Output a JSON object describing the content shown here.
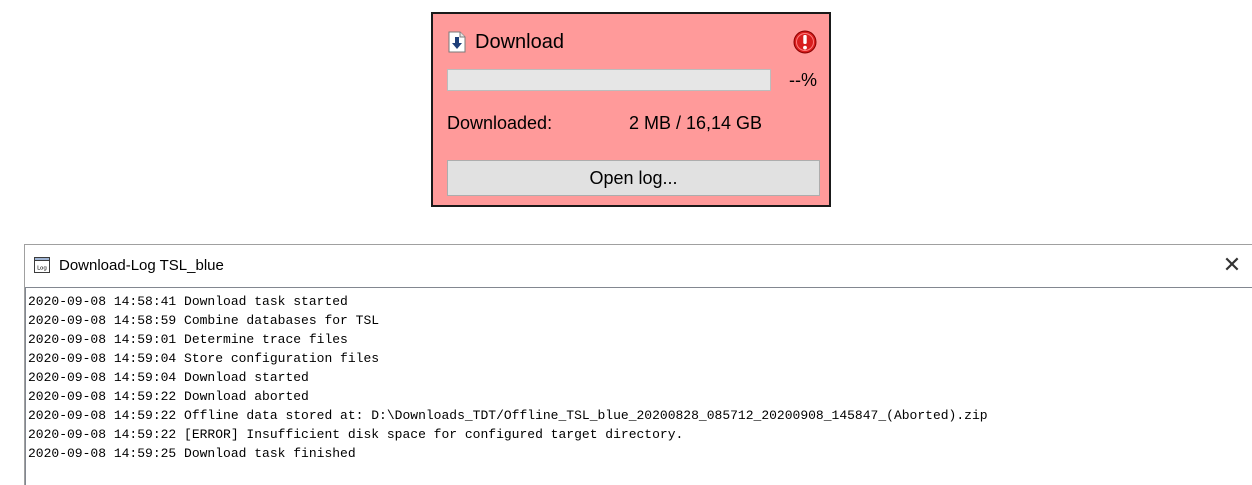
{
  "download_panel": {
    "title": "Download",
    "title_icon": "download-arrow-icon",
    "status_icon": "error-exclamation-icon",
    "background_color": "#ff9a9a",
    "progress_fraction": 0,
    "progress_percent_text": "--%",
    "downloaded_label": "Downloaded:",
    "downloaded_value": "2 MB / 16,14 GB",
    "open_log_label": "Open log..."
  },
  "log_window": {
    "title": "Download-Log TSL_blue",
    "title_icon": "log-file-icon",
    "close_icon": "close-icon",
    "close_glyph": "✕",
    "lines": [
      "2020-09-08 14:58:41 Download task started",
      "2020-09-08 14:58:59 Combine databases for TSL",
      "2020-09-08 14:59:01 Determine trace files",
      "2020-09-08 14:59:04 Store configuration files",
      "2020-09-08 14:59:04 Download started",
      "2020-09-08 14:59:22 Download aborted",
      "2020-09-08 14:59:22 Offline data stored at: D:\\Downloads_TDT/Offline_TSL_blue_20200828_085712_20200908_145847_(Aborted).zip",
      "2020-09-08 14:59:22 [ERROR] Insufficient disk space for configured target directory.",
      "2020-09-08 14:59:25 Download task finished"
    ]
  }
}
